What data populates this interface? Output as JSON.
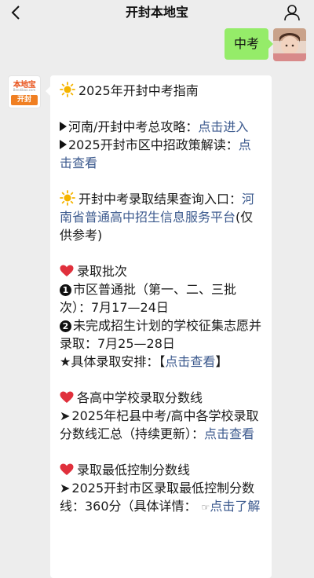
{
  "header": {
    "title": "开封本地宝"
  },
  "outgoing": {
    "text": "中考"
  },
  "bot": {
    "logo_top": "本地宝",
    "logo_url": "Bendibao.com",
    "logo_city": "开封"
  },
  "message": {
    "title": "2025年开封中考指南",
    "line1_prefix": "河南/开封中考总攻略：",
    "line1_link": "点击进入",
    "line2_prefix": "2025开封市区中招政策解读：",
    "line2_link": "点击查看",
    "result_title": "开封中考录取结果查询入口：",
    "result_link": "河南省普通高中招生信息服务平台",
    "result_suffix": "(仅供参考)",
    "batch_title": "录取批次",
    "batch1_num": "1",
    "batch1": "市区普通批（第一、二、三批次）：7月17—24日",
    "batch2_num": "2",
    "batch2": "未完成招生计划的学校征集志愿并录取：7月25—28日",
    "batch3_prefix": "★具体录取安排：【",
    "batch3_link": "点击查看",
    "batch3_suffix": "】",
    "score_title": "各高中学校录取分数线",
    "score_line_prefix": "2025年杞县中考/高中各学校录取分数线汇总（持续更新）：",
    "score_line_link": "点击查看",
    "min_title": "录取最低控制分数线",
    "min_line_prefix": "2025开封市区录取最低控制分数线：360分（具体详情：",
    "min_line_link": "点击了解"
  },
  "colors": {
    "background": "#ededed",
    "outgoing_bubble": "#95ec69",
    "link": "#3c5a8e",
    "heart": "#e0303c",
    "sun": "#f5b400"
  }
}
